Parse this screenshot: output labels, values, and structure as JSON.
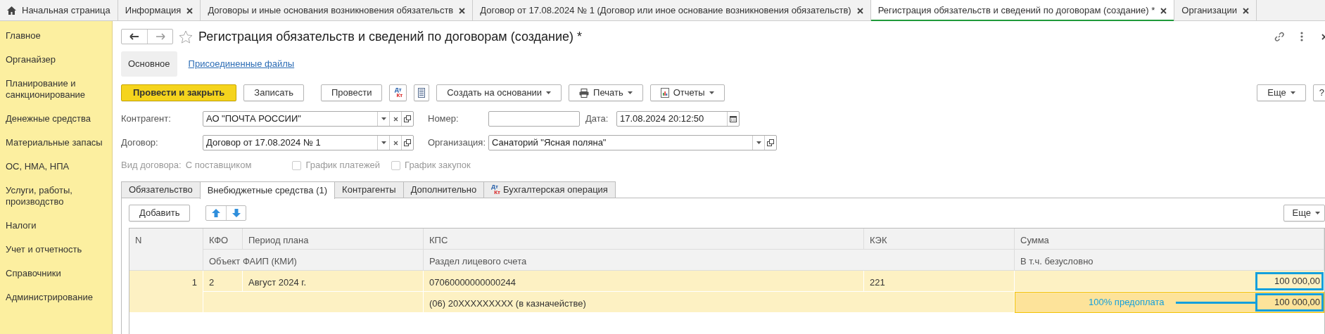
{
  "tabs": [
    {
      "label": "Начальная страница",
      "kind": "home",
      "closable": false,
      "selected": false
    },
    {
      "label": "Информация",
      "kind": "page",
      "closable": true,
      "selected": false
    },
    {
      "label": "Договоры и иные основания возникновения обязательств",
      "kind": "page",
      "closable": true,
      "selected": false
    },
    {
      "label": "Договор от 17.08.2024 № 1 (Договор или иное основание возникновения обязательств)",
      "kind": "page",
      "closable": true,
      "selected": false
    },
    {
      "label": "Регистрация обязательств и сведений по договорам (создание) *",
      "kind": "page",
      "closable": true,
      "selected": true
    },
    {
      "label": "Организации",
      "kind": "page",
      "closable": true,
      "selected": false
    }
  ],
  "sidebar": {
    "items": [
      "Главное",
      "Органайзер",
      "Планирование и санкционирование",
      "Денежные средства",
      "Материальные запасы",
      "ОС, НМА, НПА",
      "Услуги, работы, производство",
      "Налоги",
      "Учет и отчетность",
      "Справочники",
      "Администрирование"
    ]
  },
  "form": {
    "title": "Регистрация обязательств и сведений по договорам (создание) *",
    "subtabs": [
      {
        "label": "Основное",
        "selected": true
      },
      {
        "label": "Присоединенные файлы",
        "selected": false
      }
    ],
    "toolbar": [
      {
        "kind": "primary",
        "label": "Провести и закрыть"
      },
      {
        "kind": "button",
        "label": "Записать"
      },
      {
        "kind": "button",
        "label": "Провести"
      },
      {
        "kind": "dtkt",
        "top": "Дт",
        "bottom": "Кт"
      },
      {
        "kind": "calc"
      },
      {
        "kind": "dropdown",
        "label": "Создать на основании"
      },
      {
        "kind": "print",
        "label": "Печать"
      },
      {
        "kind": "reports",
        "label": "Отчеты"
      }
    ],
    "more_button": "Еще",
    "help_button": "?",
    "field_rows": [
      [
        {
          "label": "Контрагент:",
          "value": "АО \"ПОЧТА РОССИИ\"",
          "kind": "ref"
        },
        {
          "label": "Номер:",
          "kind": "text"
        },
        {
          "label": "Дата:",
          "value": "17.08.2024 20:12:50",
          "kind": "date"
        }
      ],
      [
        {
          "label": "Договор:",
          "value": "Договор от 17.08.2024 № 1",
          "kind": "ref"
        },
        {
          "label": "Организация:",
          "value": "Санаторий \"Ясная поляна\"",
          "kind": "ref_wide"
        }
      ]
    ],
    "contract_type": {
      "label": "Вид договора:",
      "value": "С поставщиком"
    },
    "checkboxes": [
      {
        "label": "График платежей",
        "checked": false
      },
      {
        "label": "График закупок",
        "checked": false
      }
    ],
    "section_tabs": [
      {
        "label": "Обязательство",
        "selected": false
      },
      {
        "label": "Внебюджетные средства (1)",
        "selected": true
      },
      {
        "label": "Контрагенты",
        "selected": false
      },
      {
        "label": "Дополнительно",
        "selected": false
      },
      {
        "label": "Бухгалтерская операция",
        "selected": false,
        "icon": {
          "top": "Дт",
          "bottom": "Кт"
        }
      }
    ],
    "table": {
      "add_button": "Добавить",
      "more_button": "Еще",
      "header_top": [
        "N",
        "КФО",
        "Период плана",
        "КПС",
        "КЭК",
        "Сумма"
      ],
      "header_bottom": [
        "Объект ФАИП (КМИ)",
        "Раздел лицевого счета",
        "В т.ч. безусловно"
      ],
      "rows": [
        {
          "n": "1",
          "kfo": "2",
          "period": "Август 2024 г.",
          "kps": "07060000000000244",
          "kek": "221",
          "sum": "100 000,00",
          "section": "(06) 20XXXXXXXXX (в казначействе)",
          "sum_unconditional": "100 000,00",
          "selected": true
        }
      ],
      "annotation": {
        "text": "100% предоплата"
      }
    }
  }
}
